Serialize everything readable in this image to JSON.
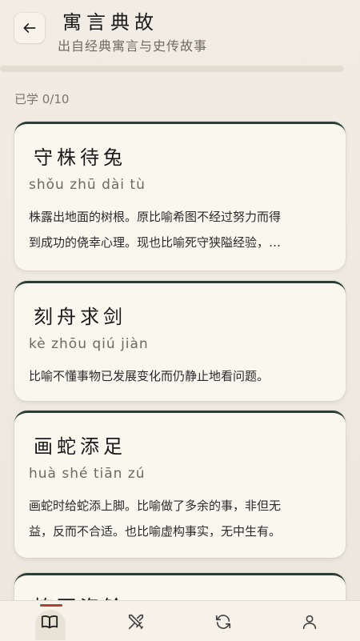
{
  "header": {
    "title": "寓言典故",
    "subtitle": "出自经典寓言与史传故事"
  },
  "progress": {
    "text": "已学 0/10",
    "learned": 0,
    "total": 10
  },
  "cards": [
    {
      "title": "守株待兔",
      "pinyin": "shǒu zhū dài tù",
      "desc_line1": "株露出地面的树根。原比喻希图不经过努力而得",
      "desc_line2": "到成功的侥幸心理。现也比喻死守狭隘经验，…"
    },
    {
      "title": "刻舟求剑",
      "pinyin": "kè zhōu qiú jiàn",
      "desc_line1": "比喻不懂事物已发展变化而仍静止地看问题。",
      "desc_line2": ""
    },
    {
      "title": "画蛇添足",
      "pinyin": "huà shé tiān zú",
      "desc_line1": "画蛇时给蛇添上脚。比喻做了多余的事，非但无",
      "desc_line2": "益，反而不合适。也比喻虚构事实，无中生有。"
    },
    {
      "title": "掩耳盗铃",
      "pinyin": "",
      "desc_line1": "",
      "desc_line2": ""
    }
  ],
  "nav": {
    "items": [
      {
        "icon": "book-icon",
        "active": true
      },
      {
        "icon": "swords-icon",
        "active": false
      },
      {
        "icon": "refresh-icon",
        "active": false
      },
      {
        "icon": "person-icon",
        "active": false
      }
    ]
  },
  "colors": {
    "background": "#efebe1",
    "card": "#faf7ef",
    "card_accent": "#2c3e34",
    "active_indicator": "#b23b3b",
    "text_muted": "#6f6b63"
  }
}
